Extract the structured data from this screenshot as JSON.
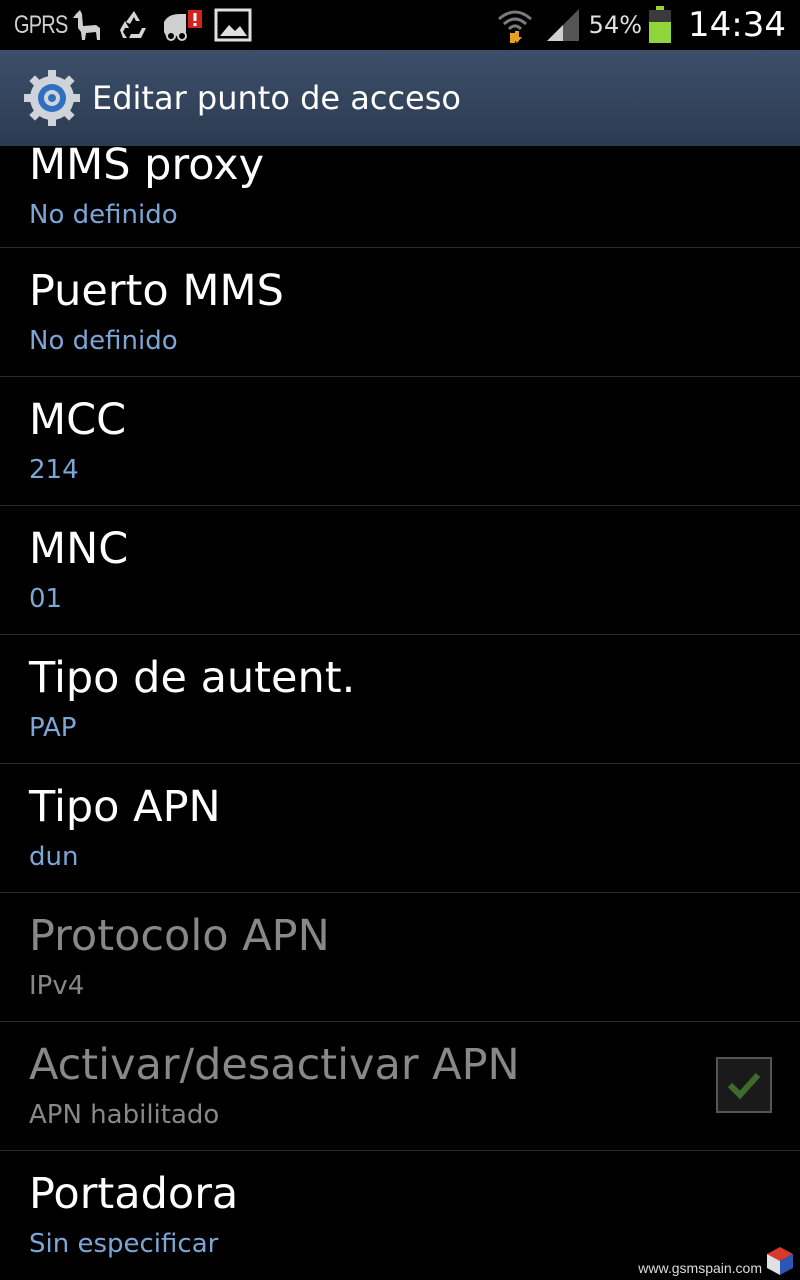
{
  "status_bar": {
    "network_label": "GPRS",
    "battery_percent": "54%",
    "time": "14:34",
    "icons": [
      "llama-icon",
      "recycle-icon",
      "truck-alert-icon",
      "image-icon",
      "wifi-icon",
      "signal-icon",
      "battery-icon"
    ]
  },
  "title_bar": {
    "icon": "settings-gear-icon",
    "title": "Editar punto de acceso"
  },
  "items": [
    {
      "label": "MMS proxy",
      "value": "No definido"
    },
    {
      "label": "Puerto MMS",
      "value": "No definido"
    },
    {
      "label": "MCC",
      "value": "214"
    },
    {
      "label": "MNC",
      "value": "01"
    },
    {
      "label": "Tipo de autent.",
      "value": "PAP"
    },
    {
      "label": "Tipo APN",
      "value": "dun"
    },
    {
      "label": "Protocolo APN",
      "value": "IPv4"
    },
    {
      "label": "Activar/desactivar APN",
      "value": "APN habilitado",
      "checked": true
    },
    {
      "label": "Portadora",
      "value": "Sin especificar"
    }
  ],
  "watermark": {
    "text": "www.gsmspain.com"
  },
  "colors": {
    "accent_value": "#7ca6d6",
    "title_bar": "#34465e",
    "disabled_text": "#888888"
  }
}
